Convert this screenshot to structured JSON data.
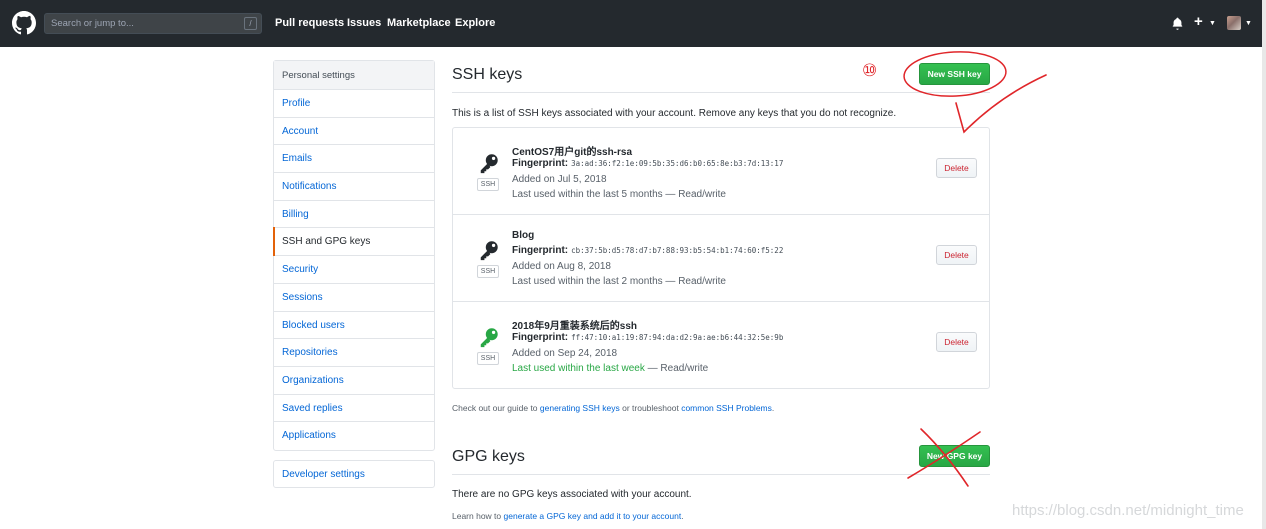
{
  "header": {
    "search_placeholder": "Search or jump to...",
    "search_shortcut": "/",
    "nav": [
      "Pull requests",
      "Issues",
      "Marketplace",
      "Explore"
    ]
  },
  "sidebar": {
    "heading": "Personal settings",
    "items": [
      "Profile",
      "Account",
      "Emails",
      "Notifications",
      "Billing",
      "SSH and GPG keys",
      "Security",
      "Sessions",
      "Blocked users",
      "Repositories",
      "Organizations",
      "Saved replies",
      "Applications"
    ],
    "selected": "SSH and GPG keys",
    "developer": "Developer settings"
  },
  "ssh": {
    "title": "SSH keys",
    "new_button": "New SSH key",
    "intro": "This is a list of SSH keys associated with your account. Remove any keys that you do not recognize.",
    "fingerprint_label": "Fingerprint:",
    "badge": "SSH",
    "delete_label": "Delete",
    "keys": [
      {
        "title": "CentOS7用户git的ssh-rsa",
        "fingerprint": "3a:ad:36:f2:1e:09:5b:35:d6:b0:65:8e:b3:7d:13:17",
        "added": "Added on Jul 5, 2018",
        "last_used": "Last used within the last 5 months",
        "access": " — Read/write",
        "recent": false
      },
      {
        "title": "Blog",
        "fingerprint": "cb:37:5b:d5:78:d7:b7:88:93:b5:54:b1:74:60:f5:22",
        "added": "Added on Aug 8, 2018",
        "last_used": "Last used within the last 2 months",
        "access": " — Read/write",
        "recent": false
      },
      {
        "title": "2018年9月重装系统后的ssh",
        "fingerprint": "ff:47:10:a1:19:87:94:da:d2:9a:ae:b6:44:32:5e:9b",
        "added": "Added on Sep 24, 2018",
        "last_used": "Last used within the last week",
        "access": " — Read/write",
        "recent": true
      }
    ],
    "footer": {
      "pre": "Check out our guide to ",
      "link1": "generating SSH keys",
      "mid": " or troubleshoot ",
      "link2": "common SSH Problems",
      "post": "."
    }
  },
  "gpg": {
    "title": "GPG keys",
    "new_button": "New GPG key",
    "empty": "There are no GPG keys associated with your account.",
    "footer": {
      "pre": "Learn how to ",
      "link": "generate a GPG key and add it to your account",
      "post": "."
    }
  },
  "annotation": {
    "number": "⑩"
  },
  "watermark": "https://blog.csdn.net/midnight_time",
  "colors": {
    "header": "#24292e",
    "link": "#0366d6",
    "green": "#28a745",
    "danger": "#cb2431",
    "annotation": "#e0262a",
    "selected_bar": "#e36209"
  }
}
